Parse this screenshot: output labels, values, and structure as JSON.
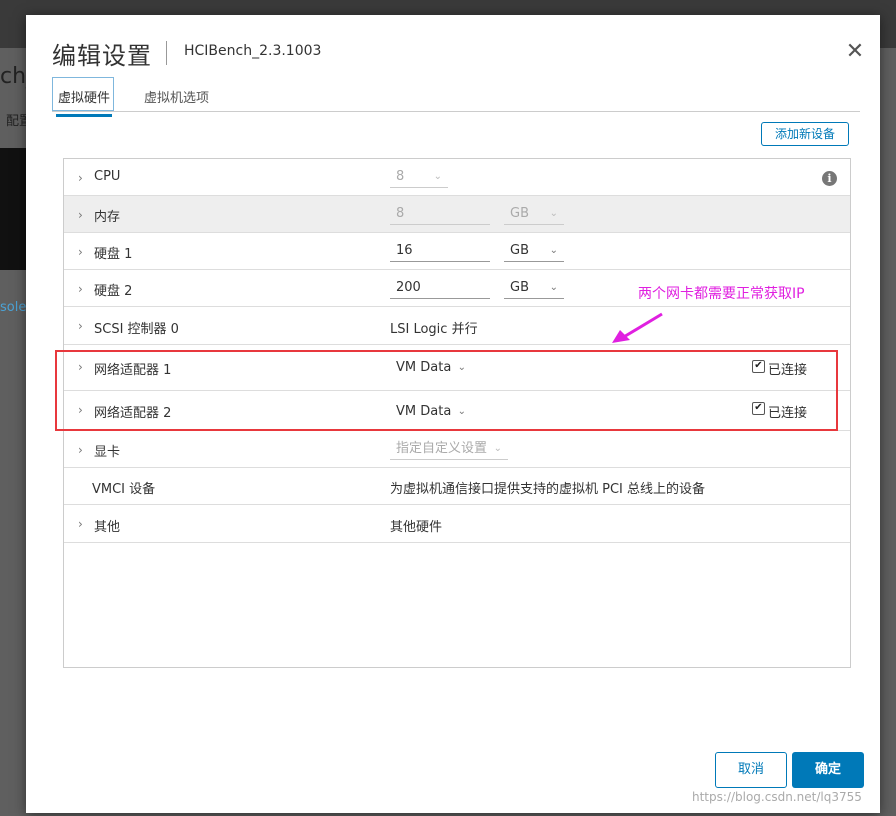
{
  "background": {
    "frag_title": "ch_",
    "frag_tab": "配置",
    "frag_link": "sole"
  },
  "dialog": {
    "title": "编辑设置",
    "subtitle": "HCIBench_2.3.1003",
    "close_icon": "close-icon",
    "tabs": [
      {
        "label": "虚拟硬件",
        "active": true
      },
      {
        "label": "虚拟机选项",
        "active": false
      }
    ],
    "add_device_label": "添加新设备",
    "rows": {
      "cpu": {
        "label": "CPU",
        "value": "8"
      },
      "memory": {
        "label": "内存",
        "value": "8",
        "unit": "GB"
      },
      "disk1": {
        "label": "硬盘 1",
        "value": "16",
        "unit": "GB"
      },
      "disk2": {
        "label": "硬盘 2",
        "value": "200",
        "unit": "GB"
      },
      "scsi": {
        "label": "SCSI 控制器 0",
        "value": "LSI Logic 并行"
      },
      "net1": {
        "label": "网络适配器 1",
        "value": "VM Data",
        "connected": "已连接"
      },
      "net2": {
        "label": "网络适配器 2",
        "value": "VM Data",
        "connected": "已连接"
      },
      "video": {
        "label": "显卡",
        "value": "指定自定义设置"
      },
      "vmci": {
        "label": "VMCI 设备",
        "value": "为虚拟机通信接口提供支持的虚拟机 PCI 总线上的设备"
      },
      "other": {
        "label": "其他",
        "value": "其他硬件"
      }
    },
    "cancel_label": "取消",
    "ok_label": "确定"
  },
  "annotation": {
    "text": "两个网卡都需要正常获取IP",
    "color": "#e020e0"
  },
  "footer_url": "https://blog.csdn.net/lq3755",
  "colors": {
    "accent": "#0079b8",
    "highlight_box": "#e8383d"
  }
}
